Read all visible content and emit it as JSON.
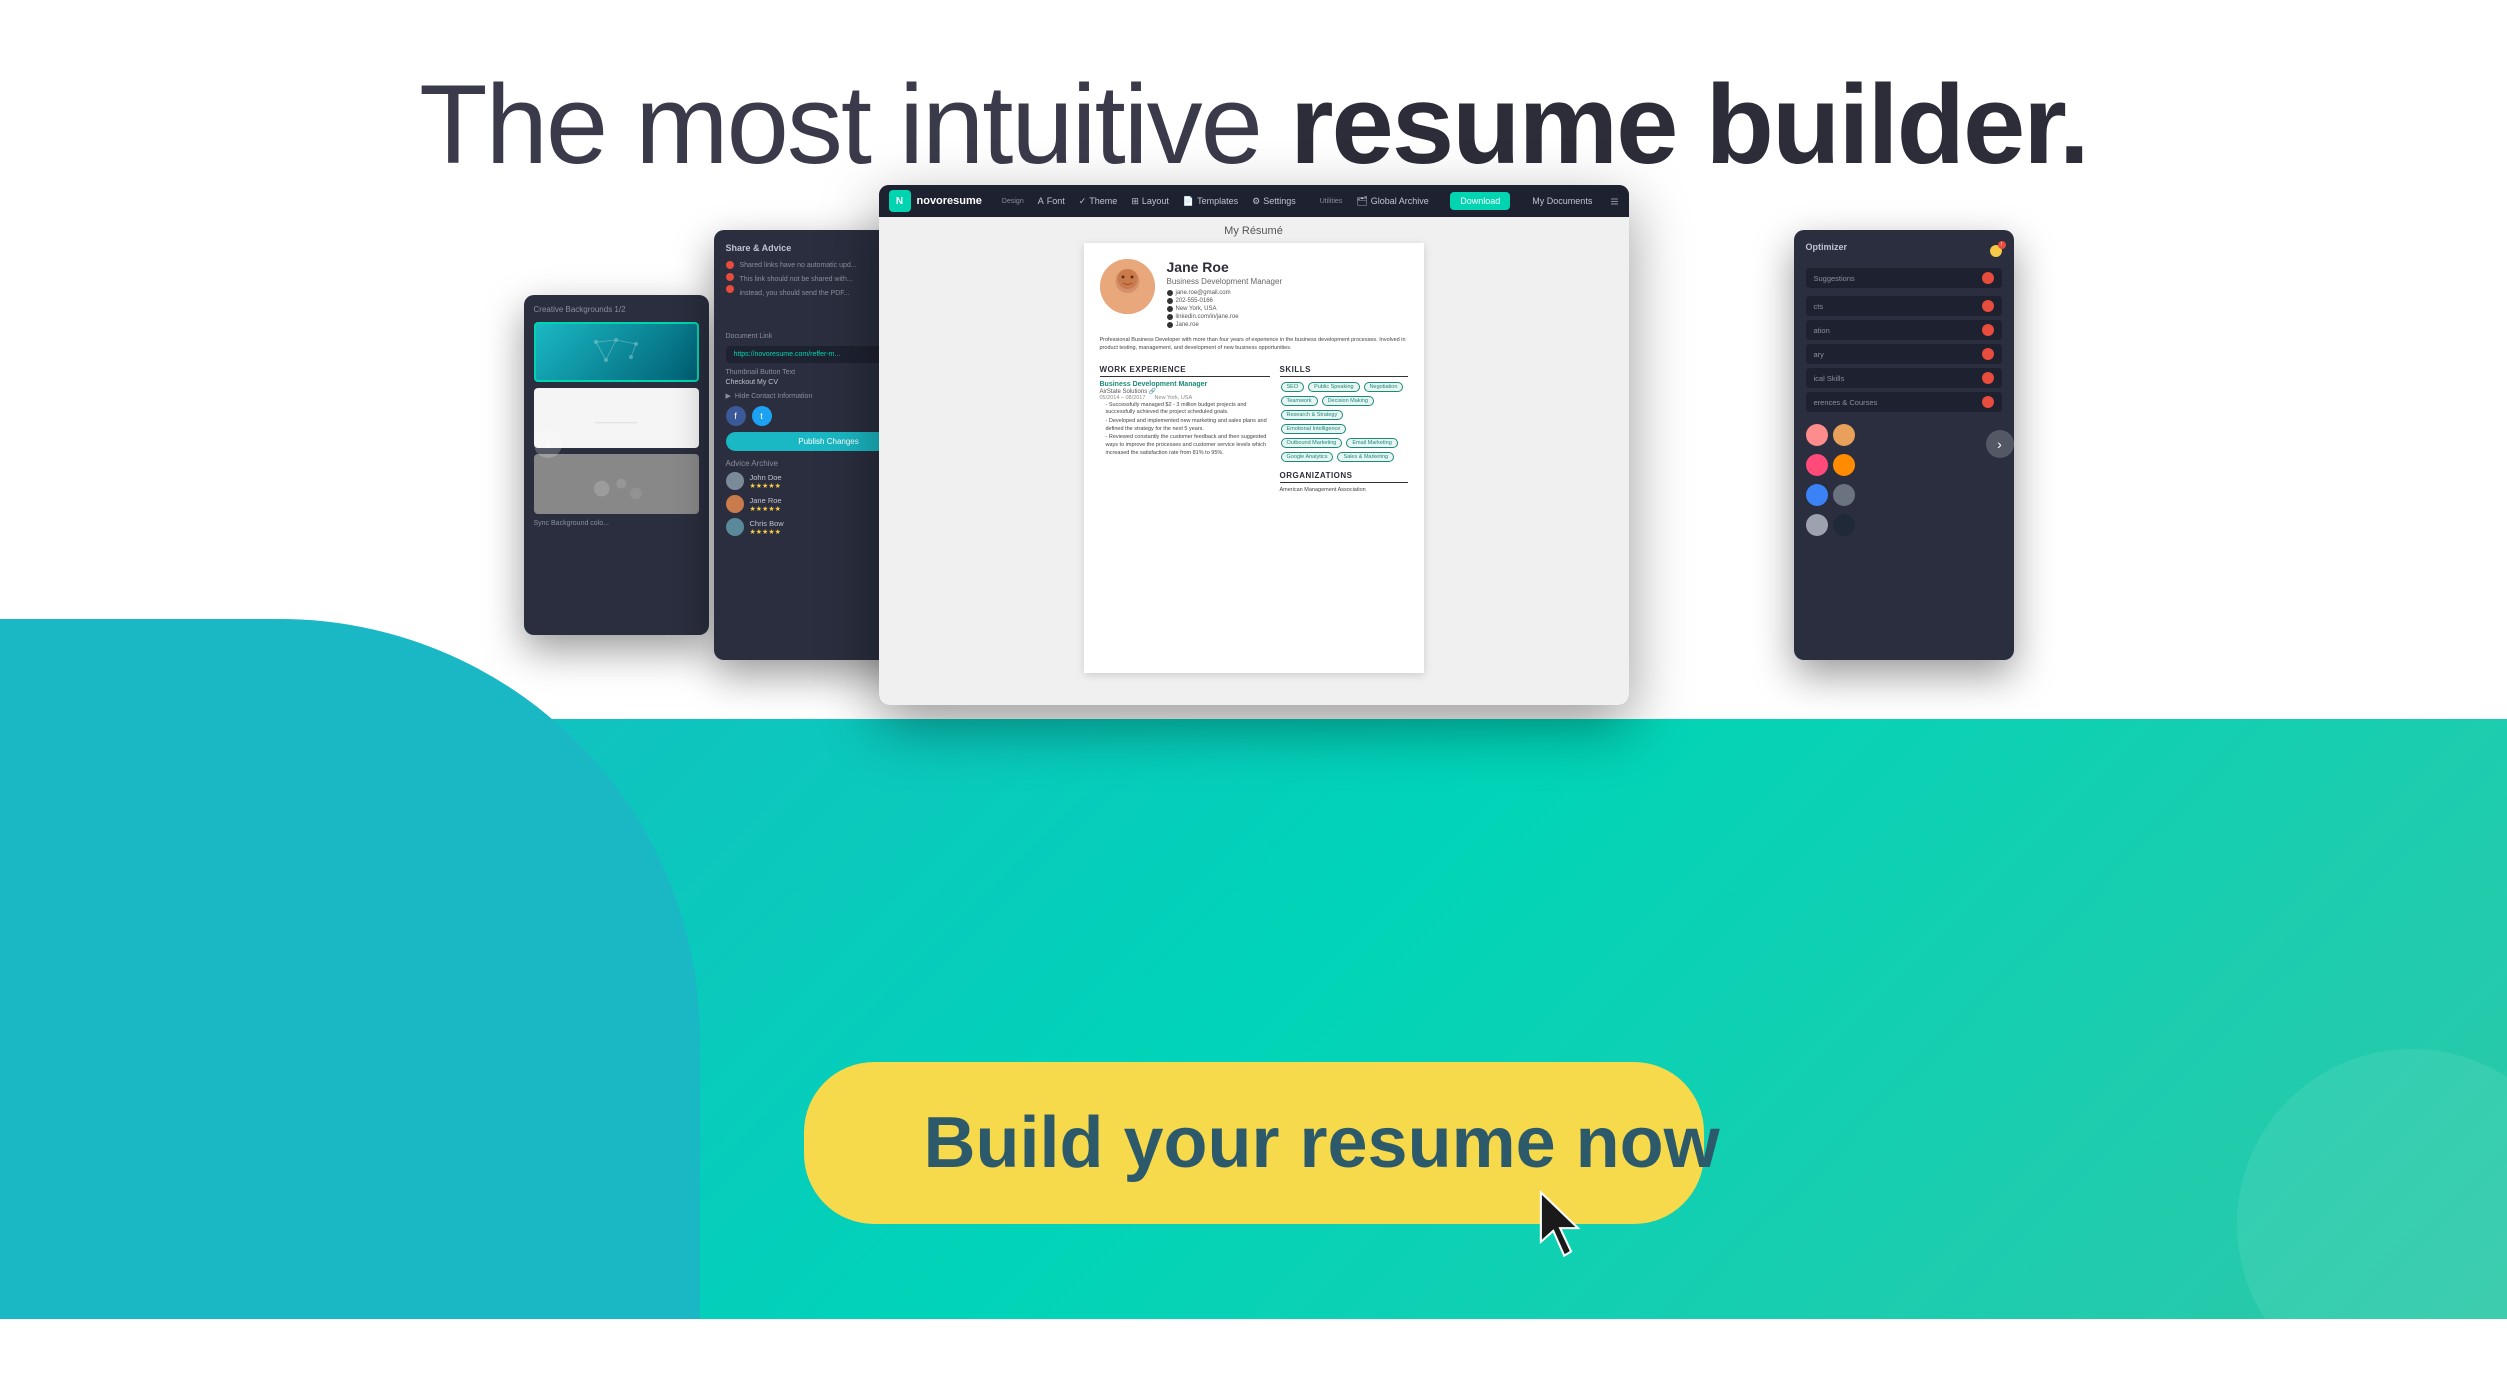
{
  "page": {
    "title": "The most intuitive resume builder.",
    "title_normal": "The most intuitive ",
    "title_bold": "resume builder.",
    "cta_button": "Build your resume now",
    "background_gradient_from": "#1ab8c4",
    "background_gradient_to": "#00d4b8"
  },
  "editor": {
    "title": "My Résumé",
    "logo_text": "novoresume",
    "nav": {
      "design_label": "Design",
      "font": "Font",
      "theme": "Theme",
      "layout": "Layout",
      "templates": "Templates",
      "settings": "Settings",
      "utilities_label": "Utilities",
      "global_archive": "Global Archive",
      "download": "Download",
      "my_documents": "My Documents"
    }
  },
  "resume": {
    "name": "Jane Roe",
    "job_title": "Business Development Manager",
    "email": "jane.roe@gmail.com",
    "phone": "202-555-0166",
    "location": "New York, USA",
    "linkedin": "linkedin.com/in/jane.roe",
    "website": "Jane.roe",
    "summary": "Professional Business Developer with more than four years of experience in the business development processes. Involved in product testing, management, and development of new business opportunities.",
    "work_experience_title": "WORK EXPERIENCE",
    "work": [
      {
        "title": "Business Development Manager",
        "company": "AirState Solutions",
        "dates": "05/2014 – 08/2017",
        "location": "New York, USA",
        "bullets": [
          "Successfully managed $2 - 3 million budget projects and successfully achieved the project scheduled goals.",
          "Developed and implemented new marketing and sales plans and defined the strategy for the next 5 years.",
          "Reviewed constantly the customer feedback and then suggested ways to improve the processes and customer service levels which increased the satisfaction rate from 81% to 95%."
        ]
      }
    ],
    "skills_title": "SKILLS",
    "skills": [
      "SEO",
      "Public Speaking",
      "Negotiation",
      "Teamwork",
      "Decision Making",
      "Research & Strategy",
      "Emotional Intelligence",
      "Outbound Marketing",
      "Email Marketing",
      "Google Analytics",
      "Sales & Marketing"
    ],
    "organizations_title": "ORGANIZATIONS",
    "organizations": [
      "American Management Association"
    ]
  },
  "share_panel": {
    "title": "Share & Advice",
    "close": "×",
    "bullet1": "Shared links have no automatic upd...",
    "bullet2": "This link should not be shared with...",
    "bullet3": "instead, you should send the PDF...",
    "document_link_label": "Document Link",
    "link_url": "https://novoresume.com/reffer-m...",
    "thumbnail_label": "Thumbnail Button Text",
    "thumbnail_text": "Checkout My CV",
    "hide_contact": "Hide Contact Information",
    "social_icons": [
      "facebook",
      "twitter"
    ],
    "publish_btn": "Publish Changes",
    "advice_title": "Advice Archive",
    "advisors": [
      {
        "name": "John Doe",
        "rating": "★★★★★"
      },
      {
        "name": "Jane Roe",
        "rating": "★★★★★"
      },
      {
        "name": "Chris Bow",
        "rating": "★★★★★"
      }
    ],
    "sync_btn": "Sync Background colo..."
  },
  "bg_panel": {
    "title": "Creative Backgrounds 1/2",
    "thumbnails": [
      "network",
      "plain",
      "gray"
    ]
  },
  "optimizer_panel": {
    "header": "Optimizer",
    "suggestion_label": "Suggestions",
    "sections": [
      {
        "label": "cts",
        "dot_color": "#ff6b6b"
      },
      {
        "label": "ation",
        "dot_color": "#ff6b6b"
      },
      {
        "label": "ary",
        "dot_color": "#ff6b6b"
      },
      {
        "label": "ical Skills",
        "dot_color": "#ff6b6b"
      },
      {
        "label": "erences & Courses",
        "dot_color": "#ff6b6b"
      }
    ],
    "color_groups": [
      [
        "#ff8c8c",
        "#e8a05a"
      ],
      [
        "#ff4a7a",
        "#ff8c00"
      ],
      [
        "#3b82f6",
        "#6b7280"
      ],
      [
        "#9ca3af",
        "#1f2937"
      ]
    ]
  }
}
